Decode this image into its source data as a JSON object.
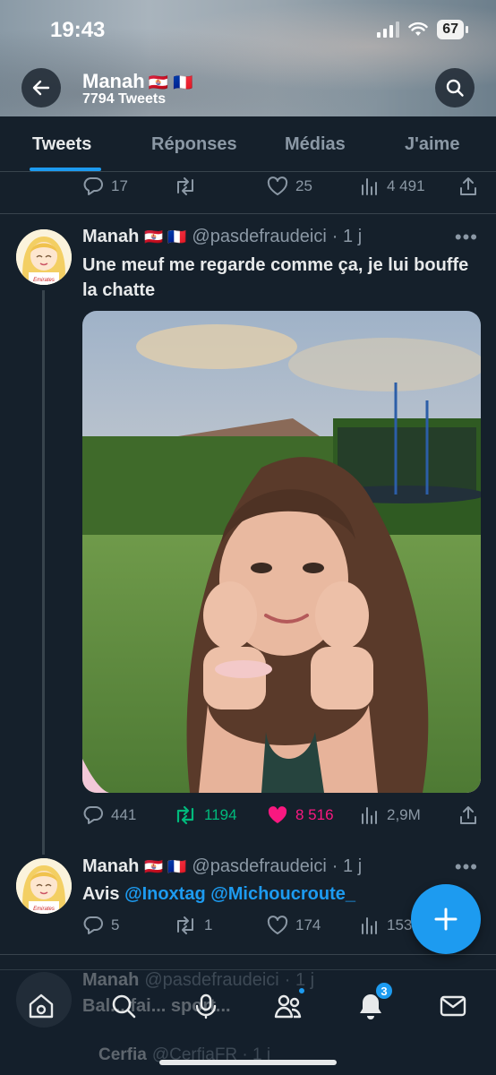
{
  "status_bar": {
    "time": "19:43",
    "battery": "67"
  },
  "header": {
    "name": "Manah",
    "flags": "🇵🇫 🇫🇷",
    "tweet_count": "7794 Tweets"
  },
  "tabs": [
    {
      "label": "Tweets",
      "active": true
    },
    {
      "label": "Réponses",
      "active": false
    },
    {
      "label": "Médias",
      "active": false
    },
    {
      "label": "J'aime",
      "active": false
    }
  ],
  "top_actions": {
    "replies": "17",
    "retweets": "",
    "likes": "25",
    "views": "4 491"
  },
  "tweet1": {
    "name": "Manah",
    "flags": "🇵🇫 🇫🇷",
    "handle": "@pasdefraudeici",
    "time": "· 1 j",
    "text": "Une meuf me regarde comme ça, je lui bouffe la chatte",
    "replies": "441",
    "retweets": "1194",
    "likes": "8 516",
    "views": "2,9M"
  },
  "tweet2": {
    "name": "Manah",
    "flags": "🇵🇫 🇫🇷",
    "handle": "@pasdefraudeici",
    "time": "· 1 j",
    "text_prefix": "Avis ",
    "mention1": "@Inoxtag",
    "mention2": "@Michoucroute_",
    "replies": "5",
    "retweets": "1",
    "likes": "174",
    "views": "153"
  },
  "tweet3_faded": {
    "name": "Manah",
    "handle": "@pasdefraudeici",
    "time": "· 1 j",
    "text": "Bal... fai... sport...",
    "quoted_name": "Cerfia",
    "quoted_handle": "@CerfiaFR · 1 j"
  },
  "avatar_caption": "Emirates",
  "bottom_nav": {
    "notifications_badge": "3"
  },
  "colors": {
    "background": "#15202b",
    "accent": "#1d9bf0",
    "retweet": "#00ba7c",
    "like": "#f91880",
    "muted": "#8b98a5"
  }
}
